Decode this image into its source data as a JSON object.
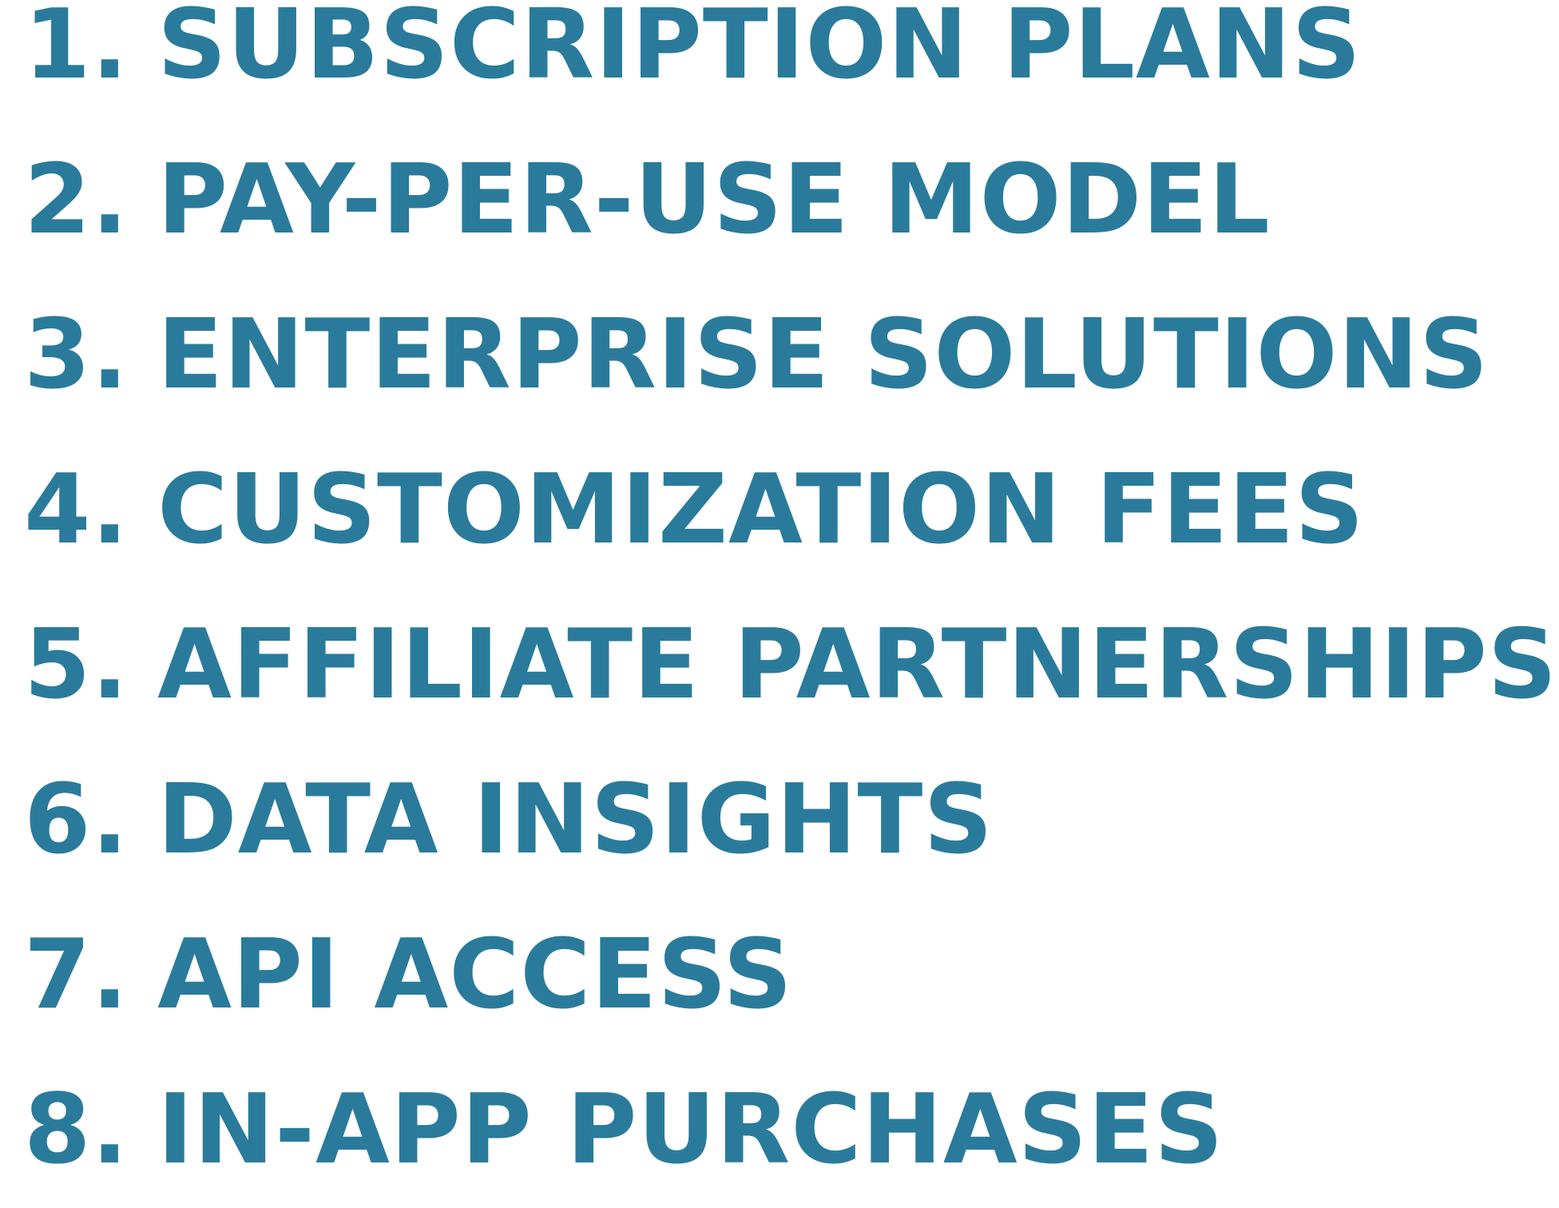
{
  "accent_color": "#2a7b9b",
  "items": [
    {
      "number": "1",
      "label": "SUBSCRIPTION PLANS"
    },
    {
      "number": "2",
      "label": "PAY-PER-USE MODEL"
    },
    {
      "number": "3",
      "label": "ENTERPRISE SOLUTIONS"
    },
    {
      "number": "4",
      "label": "CUSTOMIZATION FEES"
    },
    {
      "number": "5",
      "label": "AFFILIATE PARTNERSHIPS"
    },
    {
      "number": "6",
      "label": "DATA INSIGHTS"
    },
    {
      "number": "7",
      "label": "API ACCESS"
    },
    {
      "number": "8",
      "label": "IN-APP PURCHASES"
    }
  ]
}
